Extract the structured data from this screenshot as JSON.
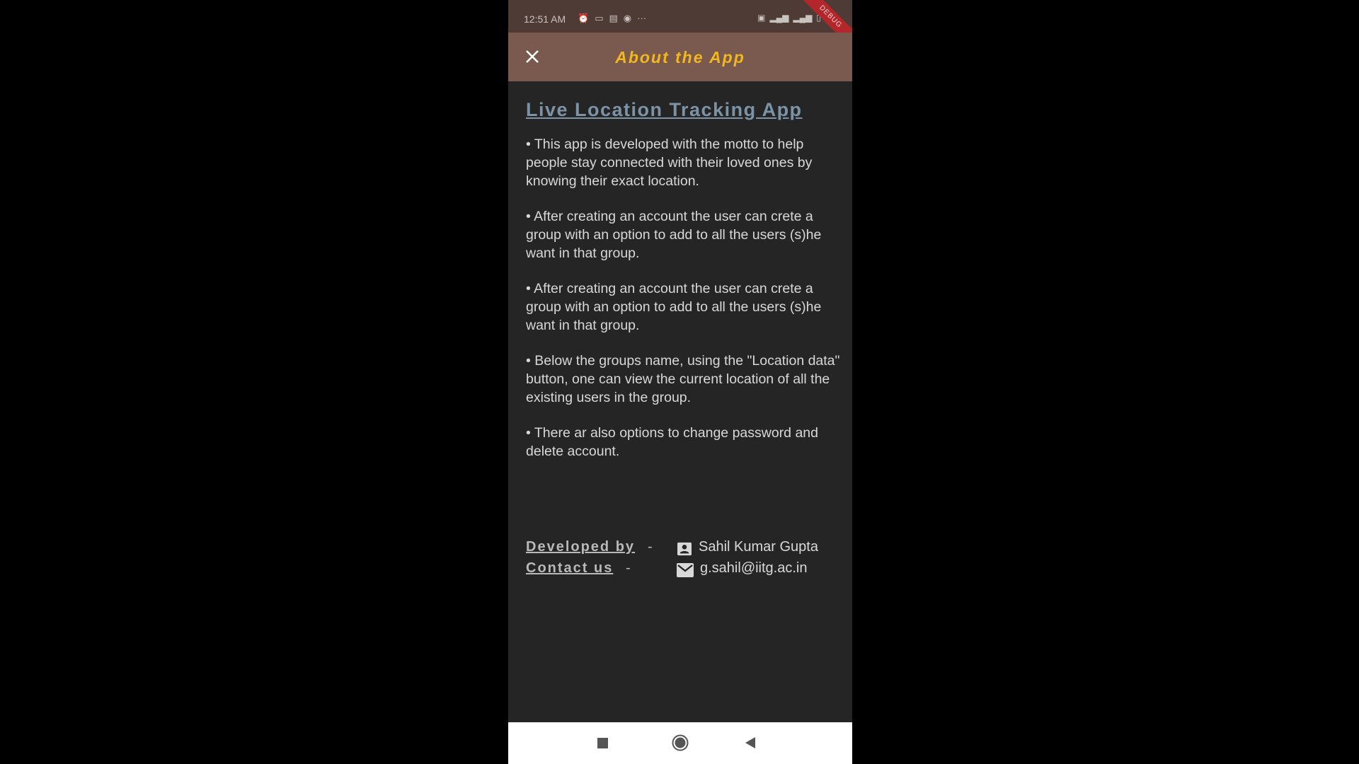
{
  "status_bar": {
    "time": "12:51 AM",
    "more": "···",
    "debug_banner": "DEBUG"
  },
  "app_bar": {
    "close_icon": "close-icon",
    "title": "About the App",
    "title_color": "#f2b81d",
    "background": "#7a5a4f"
  },
  "main": {
    "heading": "Live Location Tracking App",
    "heading_color": "#7c93a6",
    "paragraphs": [
      "• This app is developed with the motto to help people stay connected with their loved ones by knowing their exact location.",
      "• After creating an account the user can crete a group with an option to add to all the users (s)he want in that group.",
      "• After creating an account the user can crete a group with an option to add to all the users (s)he want in that group.",
      "• Below the groups name, using the \"Location data\" button, one can view the current location of all the existing users in the group.",
      "• There ar also options to change password and delete account."
    ]
  },
  "footer": {
    "developed_by_label": "Developed by",
    "developer_icon": "contact-card-icon",
    "developer_name": "Sahil Kumar Gupta",
    "contact_label": "Contact us",
    "email_icon": "mail-icon",
    "email": "g.sahil@iitg.ac.in",
    "separator": "-"
  },
  "nav_bar": {
    "recents_icon": "square-icon",
    "home_icon": "circle-icon",
    "back_icon": "triangle-back-icon"
  }
}
